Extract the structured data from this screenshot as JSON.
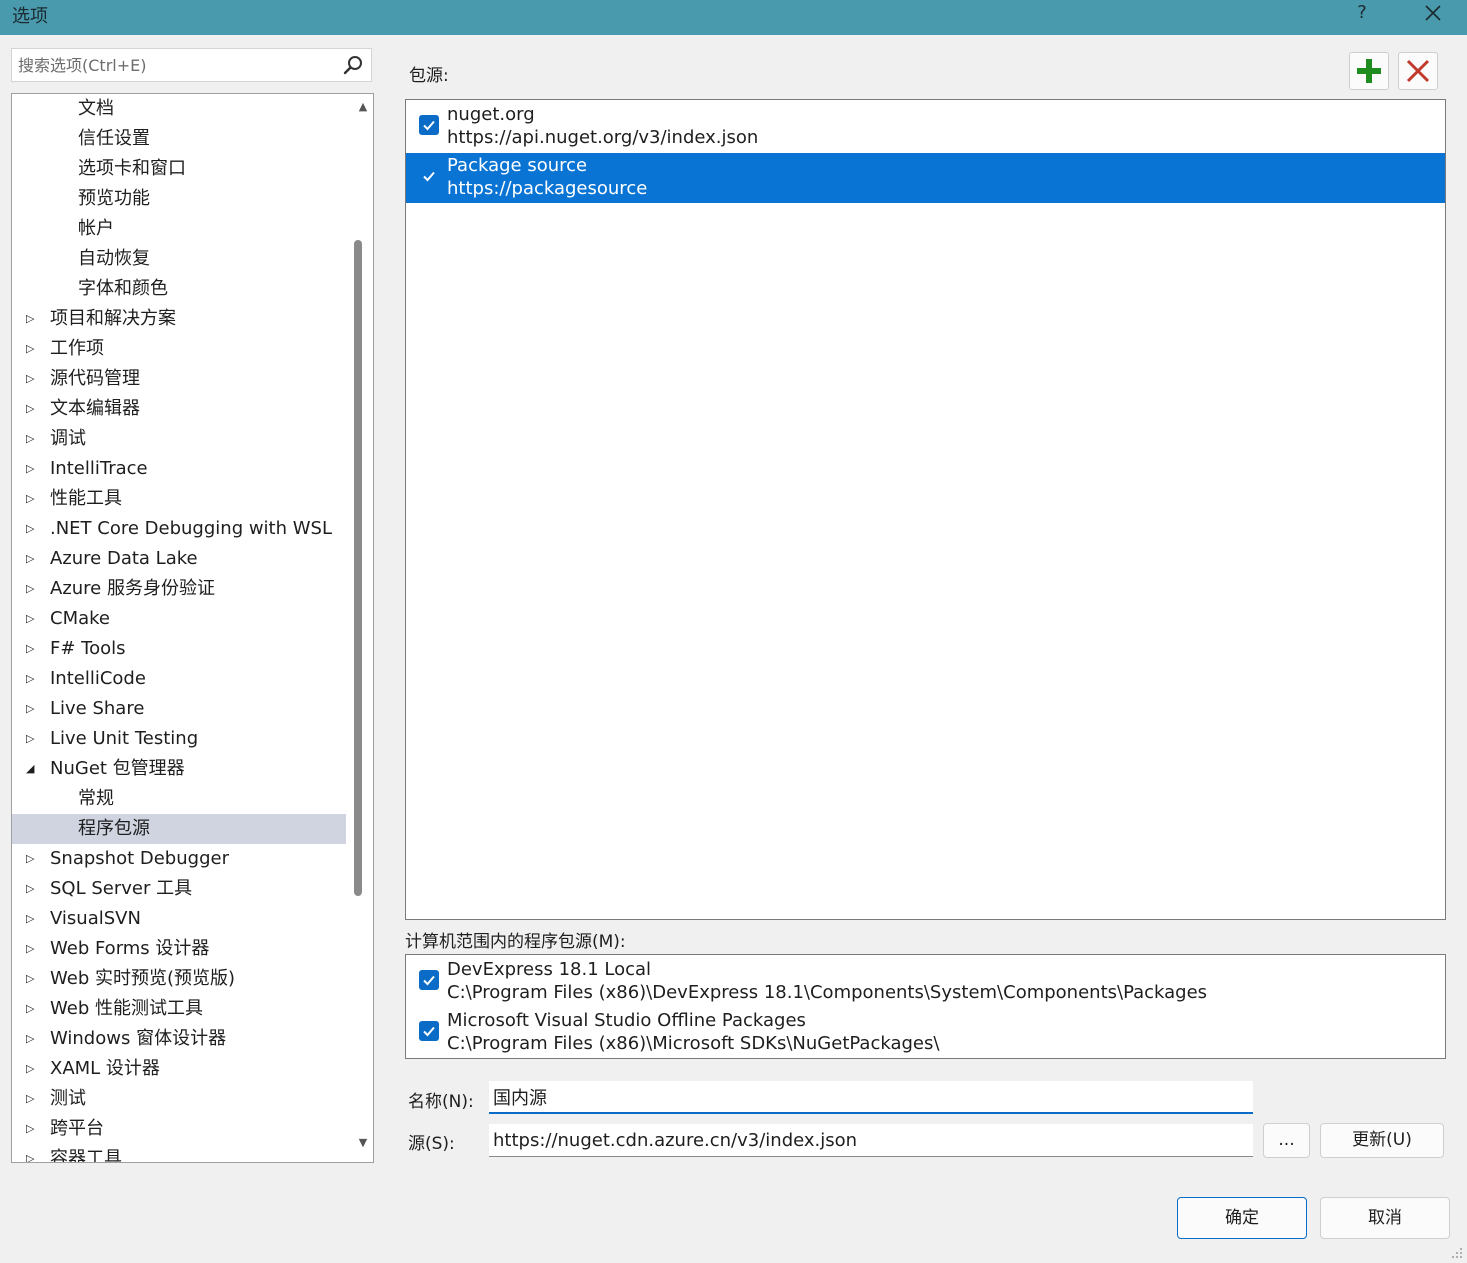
{
  "window": {
    "title": "选项",
    "help": "?",
    "close": "✕"
  },
  "search": {
    "placeholder": "搜索选项(Ctrl+E)"
  },
  "tree": {
    "items": [
      {
        "label": "文档",
        "level": 1,
        "expander": "none"
      },
      {
        "label": "信任设置",
        "level": 1,
        "expander": "none"
      },
      {
        "label": "选项卡和窗口",
        "level": 1,
        "expander": "none"
      },
      {
        "label": "预览功能",
        "level": 1,
        "expander": "none"
      },
      {
        "label": "帐户",
        "level": 1,
        "expander": "none"
      },
      {
        "label": "自动恢复",
        "level": 1,
        "expander": "none"
      },
      {
        "label": "字体和颜色",
        "level": 1,
        "expander": "none"
      },
      {
        "label": "项目和解决方案",
        "level": 0,
        "expander": "collapsed"
      },
      {
        "label": "工作项",
        "level": 0,
        "expander": "collapsed"
      },
      {
        "label": "源代码管理",
        "level": 0,
        "expander": "collapsed"
      },
      {
        "label": "文本编辑器",
        "level": 0,
        "expander": "collapsed"
      },
      {
        "label": "调试",
        "level": 0,
        "expander": "collapsed"
      },
      {
        "label": "IntelliTrace",
        "level": 0,
        "expander": "collapsed"
      },
      {
        "label": "性能工具",
        "level": 0,
        "expander": "collapsed"
      },
      {
        "label": ".NET Core Debugging with WSL",
        "level": 0,
        "expander": "collapsed"
      },
      {
        "label": "Azure Data Lake",
        "level": 0,
        "expander": "collapsed"
      },
      {
        "label": "Azure 服务身份验证",
        "level": 0,
        "expander": "collapsed"
      },
      {
        "label": "CMake",
        "level": 0,
        "expander": "collapsed"
      },
      {
        "label": "F# Tools",
        "level": 0,
        "expander": "collapsed"
      },
      {
        "label": "IntelliCode",
        "level": 0,
        "expander": "collapsed"
      },
      {
        "label": "Live Share",
        "level": 0,
        "expander": "collapsed"
      },
      {
        "label": "Live Unit Testing",
        "level": 0,
        "expander": "collapsed"
      },
      {
        "label": "NuGet 包管理器",
        "level": 0,
        "expander": "expanded"
      },
      {
        "label": "常规",
        "level": 1,
        "expander": "none"
      },
      {
        "label": "程序包源",
        "level": 1,
        "expander": "none",
        "selected": true
      },
      {
        "label": "Snapshot Debugger",
        "level": 0,
        "expander": "collapsed"
      },
      {
        "label": "SQL Server 工具",
        "level": 0,
        "expander": "collapsed"
      },
      {
        "label": "VisualSVN",
        "level": 0,
        "expander": "collapsed"
      },
      {
        "label": "Web Forms 设计器",
        "level": 0,
        "expander": "collapsed"
      },
      {
        "label": "Web 实时预览(预览版)",
        "level": 0,
        "expander": "collapsed"
      },
      {
        "label": "Web 性能测试工具",
        "level": 0,
        "expander": "collapsed"
      },
      {
        "label": "Windows 窗体设计器",
        "level": 0,
        "expander": "collapsed"
      },
      {
        "label": "XAML 设计器",
        "level": 0,
        "expander": "collapsed"
      },
      {
        "label": "测试",
        "level": 0,
        "expander": "collapsed"
      },
      {
        "label": "跨平台",
        "level": 0,
        "expander": "collapsed"
      },
      {
        "label": "容器工具",
        "level": 0,
        "expander": "collapsed"
      }
    ],
    "scroll_position_fraction": 0.35,
    "scroll_visible_fraction": 0.65
  },
  "package_sources": {
    "label": "包源:",
    "items": [
      {
        "name": "nuget.org",
        "url": "https://api.nuget.org/v3/index.json",
        "checked": true,
        "selected": false
      },
      {
        "name": "Package source",
        "url": "https://packagesource",
        "checked": true,
        "selected": true
      }
    ]
  },
  "machine_sources": {
    "label": "计算机范围内的程序包源(M):",
    "items": [
      {
        "name": "DevExpress 18.1 Local",
        "url": "C:\\Program Files (x86)\\DevExpress 18.1\\Components\\System\\Components\\Packages",
        "checked": true
      },
      {
        "name": "Microsoft Visual Studio Offline Packages",
        "url": "C:\\Program Files (x86)\\Microsoft SDKs\\NuGetPackages\\",
        "checked": true
      }
    ]
  },
  "form": {
    "name_label": "名称(N):",
    "name_value": "国内源",
    "source_label": "源(S):",
    "source_value": "https://nuget.cdn.azure.cn/v3/index.json",
    "browse_label": "...",
    "update_label": "更新(U)"
  },
  "footer": {
    "ok_label": "确定",
    "cancel_label": "取消"
  },
  "colors": {
    "titlebar": "#4a9aad",
    "selection": "#0a74d4",
    "accent": "#0a6cc7",
    "tree_selection": "#cfd4e0",
    "add_icon": "#1e8c1e",
    "delete_icon": "#c0392b"
  }
}
